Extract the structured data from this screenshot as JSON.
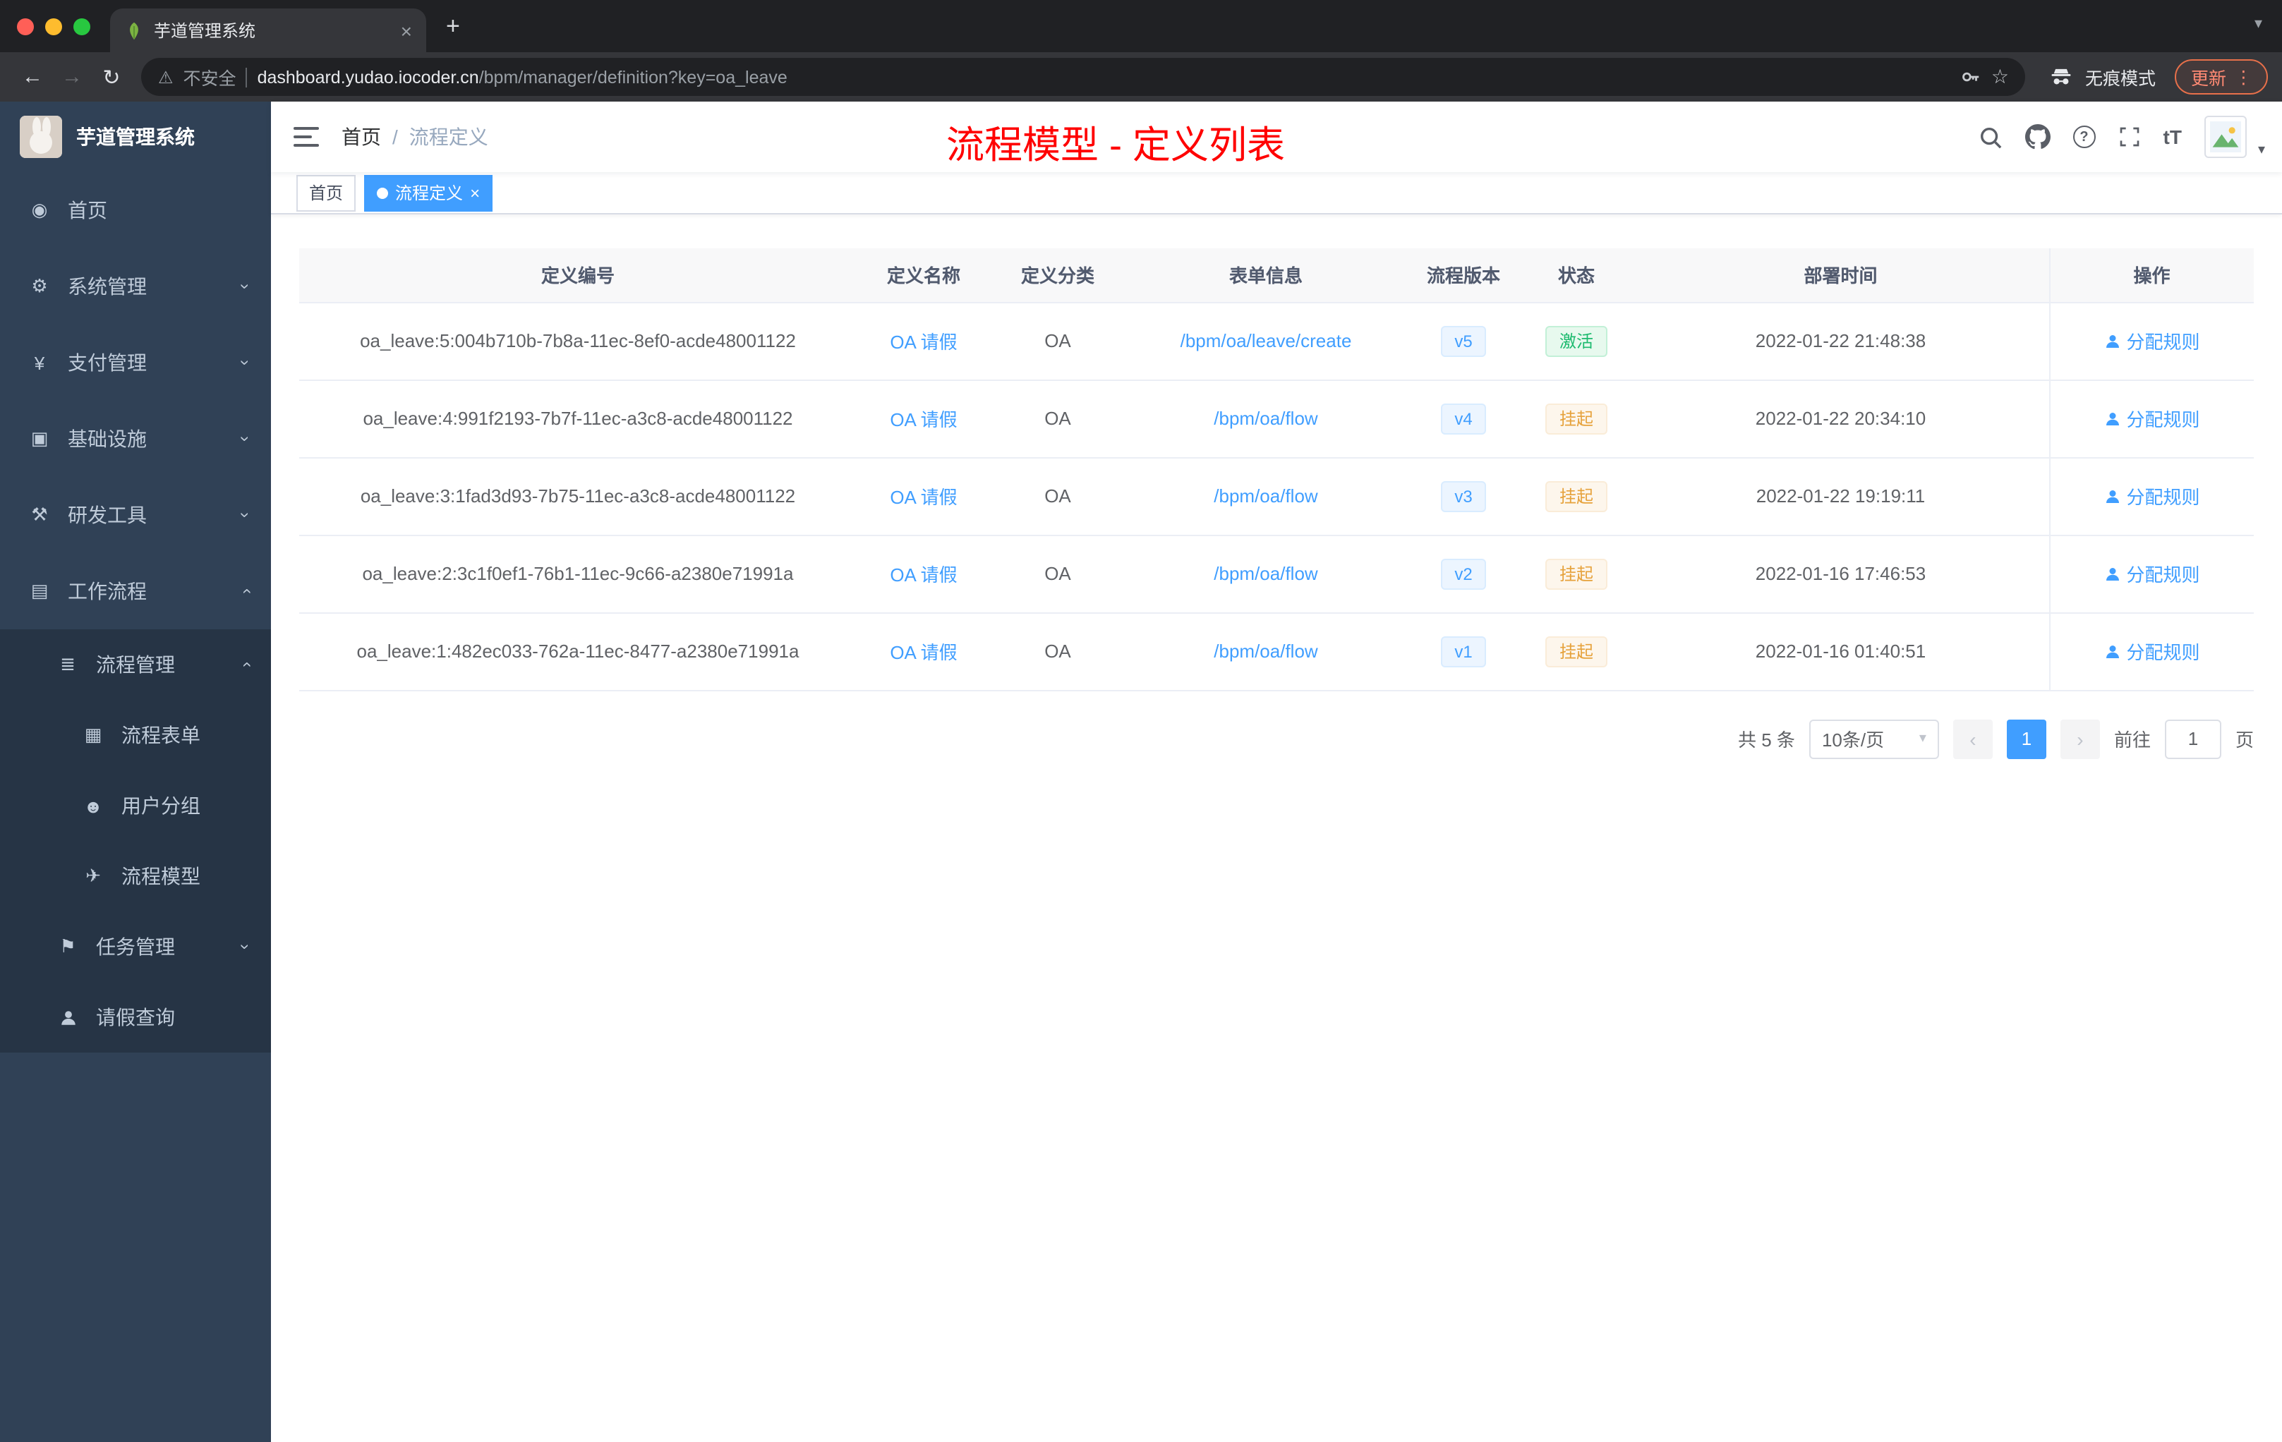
{
  "icons": {
    "dashboard": "◉",
    "gear": "⚙",
    "yen": "¥",
    "infrastructure": "▣",
    "tools": "⚒",
    "workflow": "▤",
    "process": "≣",
    "form": "▦",
    "group": "☻",
    "model": "✈",
    "task": "⚑",
    "chevron": "›",
    "close": "×",
    "plus": "+",
    "dots": "⋮",
    "warning": "⚠",
    "star": "☆",
    "reload": "↻",
    "back": "←",
    "forward": "→",
    "caret": "▾",
    "question": "?",
    "font_size": "tT"
  },
  "browser": {
    "tab": {
      "title": "芋道管理系统"
    },
    "toolbar": {
      "security_label": "不安全",
      "url_domain": "dashboard.yudao.iocoder.cn",
      "url_path": "/bpm/manager/definition?key=oa_leave",
      "incognito_label": "无痕模式",
      "update_label": "更新"
    }
  },
  "sidebar": {
    "logo_title": "芋道管理系统",
    "menu": [
      {
        "label": "首页"
      },
      {
        "label": "系统管理"
      },
      {
        "label": "支付管理"
      },
      {
        "label": "基础设施"
      },
      {
        "label": "研发工具"
      },
      {
        "label": "工作流程"
      },
      {
        "label": "流程管理"
      },
      {
        "label": "流程表单"
      },
      {
        "label": "用户分组"
      },
      {
        "label": "流程模型"
      },
      {
        "label": "任务管理"
      },
      {
        "label": "请假查询"
      }
    ]
  },
  "header": {
    "breadcrumb": {
      "home": "首页",
      "separator": "/",
      "current": "流程定义"
    },
    "annotation": "流程模型 - 定义列表"
  },
  "tags": {
    "home": "首页",
    "current": "流程定义"
  },
  "table": {
    "columns": [
      "定义编号",
      "定义名称",
      "定义分类",
      "表单信息",
      "流程版本",
      "状态",
      "部署时间",
      "操作"
    ],
    "rows": [
      {
        "id": "oa_leave:5:004b710b-7b8a-11ec-8ef0-acde48001122",
        "name": "OA 请假",
        "category": "OA",
        "form": "/bpm/oa/leave/create",
        "version": "v5",
        "status": "激活",
        "status_type": "success",
        "time": "2022-01-22 21:48:38",
        "action": "分配规则"
      },
      {
        "id": "oa_leave:4:991f2193-7b7f-11ec-a3c8-acde48001122",
        "name": "OA 请假",
        "category": "OA",
        "form": "/bpm/oa/flow",
        "version": "v4",
        "status": "挂起",
        "status_type": "warning",
        "time": "2022-01-22 20:34:10",
        "action": "分配规则"
      },
      {
        "id": "oa_leave:3:1fad3d93-7b75-11ec-a3c8-acde48001122",
        "name": "OA 请假",
        "category": "OA",
        "form": "/bpm/oa/flow",
        "version": "v3",
        "status": "挂起",
        "status_type": "warning",
        "time": "2022-01-22 19:19:11",
        "action": "分配规则"
      },
      {
        "id": "oa_leave:2:3c1f0ef1-76b1-11ec-9c66-a2380e71991a",
        "name": "OA 请假",
        "category": "OA",
        "form": "/bpm/oa/flow",
        "version": "v2",
        "status": "挂起",
        "status_type": "warning",
        "time": "2022-01-16 17:46:53",
        "action": "分配规则"
      },
      {
        "id": "oa_leave:1:482ec033-762a-11ec-8477-a2380e71991a",
        "name": "OA 请假",
        "category": "OA",
        "form": "/bpm/oa/flow",
        "version": "v1",
        "status": "挂起",
        "status_type": "warning",
        "time": "2022-01-16 01:40:51",
        "action": "分配规则"
      }
    ]
  },
  "pagination": {
    "total": "共 5 条",
    "page_size": "10条/页",
    "prev": "‹",
    "page": "1",
    "next": "›",
    "goto_label": "前往",
    "goto_value": "1",
    "unit": "页"
  }
}
